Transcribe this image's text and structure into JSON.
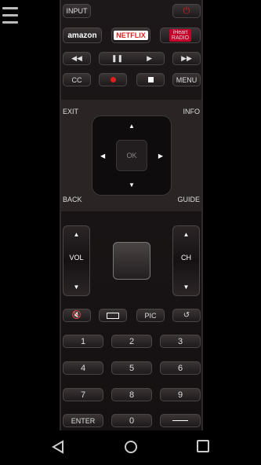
{
  "top": {
    "input_label": "INPUT",
    "power_icon": "power-icon"
  },
  "apps": {
    "amazon": "amazon",
    "netflix": "NETFLIX",
    "iheart_line1": "iHeart",
    "iheart_line2": "RADIO"
  },
  "transport": {
    "rewind": "◀◀",
    "pause": "❚❚",
    "play": "▶",
    "ffwd": "▶▶"
  },
  "row3": {
    "cc": "CC",
    "menu": "MENU"
  },
  "dpad": {
    "exit": "EXIT",
    "info": "INFO",
    "back": "BACK",
    "guide": "GUIDE",
    "ok": "OK",
    "up": "▲",
    "down": "▼",
    "left": "◀",
    "right": "▶"
  },
  "vol": {
    "label": "VOL",
    "up": "▲",
    "down": "▼"
  },
  "ch": {
    "label": "CH",
    "up": "▲",
    "down": "▼"
  },
  "row_func": {
    "mute": "mute-icon",
    "wide": "wide-icon",
    "pic": "PIC",
    "back": "last-channel-icon"
  },
  "keypad": {
    "k1": "1",
    "k2": "2",
    "k3": "3",
    "k4": "4",
    "k5": "5",
    "k6": "6",
    "k7": "7",
    "k8": "8",
    "k9": "9",
    "enter": "ENTER",
    "k0": "0"
  },
  "colors": {
    "netflix": "#e01e1e",
    "iheart": "#c6002b",
    "record": "#e01e1e"
  }
}
